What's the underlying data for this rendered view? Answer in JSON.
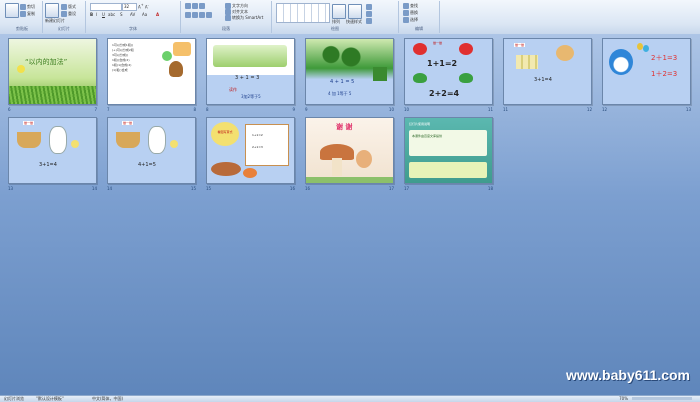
{
  "ribbon": {
    "groups": [
      "剪贴板",
      "幻灯片",
      "字体",
      "段落",
      "绘图",
      "编辑"
    ],
    "new_slide_label": "新建幻灯片",
    "font_size": "32",
    "arrange_label": "排列",
    "quick_styles_label": "快速样式",
    "find_label": "查找",
    "replace_label": "替换",
    "select_label": "选择",
    "smartart_label": "转换为 SmartArt"
  },
  "slides": [
    {
      "index": "6",
      "number": "7",
      "title": "“以内的加法”"
    },
    {
      "index": "7",
      "number": "8",
      "lines": [
        "1可以分成1和()",
        "(+)可以分成2和",
        "3可以分成()",
        "1和()合成(2)",
        "1和(1)合成(2)",
        "(1)和()合成"
      ]
    },
    {
      "index": "8",
      "number": "9",
      "equation": "3 + 1 = 3",
      "caption_a": "读作",
      "caption_b": "3加2等于5"
    },
    {
      "index": "9",
      "number": "10",
      "equation": "4 + 1 = 5",
      "caption": "4 加 1等于 5"
    },
    {
      "index": "10",
      "number": "11",
      "badge": "做一做",
      "eq1": "1+1=2",
      "eq2": "2+2=4"
    },
    {
      "index": "11",
      "number": "12",
      "badge": "做一做",
      "eq": "3+1=4"
    },
    {
      "index": "12",
      "number": "13",
      "eq1": "2＋1=3",
      "eq2": "1＋2=3"
    },
    {
      "index": "13",
      "number": "14",
      "badge": "做一做",
      "eq": "3+1=4"
    },
    {
      "index": "14",
      "number": "15",
      "badge": "做一做",
      "eq": "4+1=5"
    },
    {
      "index": "15",
      "number": "16",
      "badge": "看图写算式",
      "lines": [
        "1+1=2",
        "2+1=3"
      ]
    },
    {
      "index": "16",
      "number": "17",
      "title": "谢 谢"
    },
    {
      "index": "17",
      "number": "18",
      "heading": "幻灯片使用说明",
      "body": "本课件由百度文库提供"
    }
  ],
  "watermark": "www.baby611.com",
  "status": {
    "view": "幻灯片浏览",
    "theme": "\"默认设计模板\"",
    "language": "中文(简体，中国)",
    "zoom": "70%"
  },
  "colors": {
    "ribbon_bg": "#dbe6f4",
    "workspace": "#7c9fd0",
    "accent_red": "#e03030",
    "slide_blue": "#b8d0f2"
  }
}
